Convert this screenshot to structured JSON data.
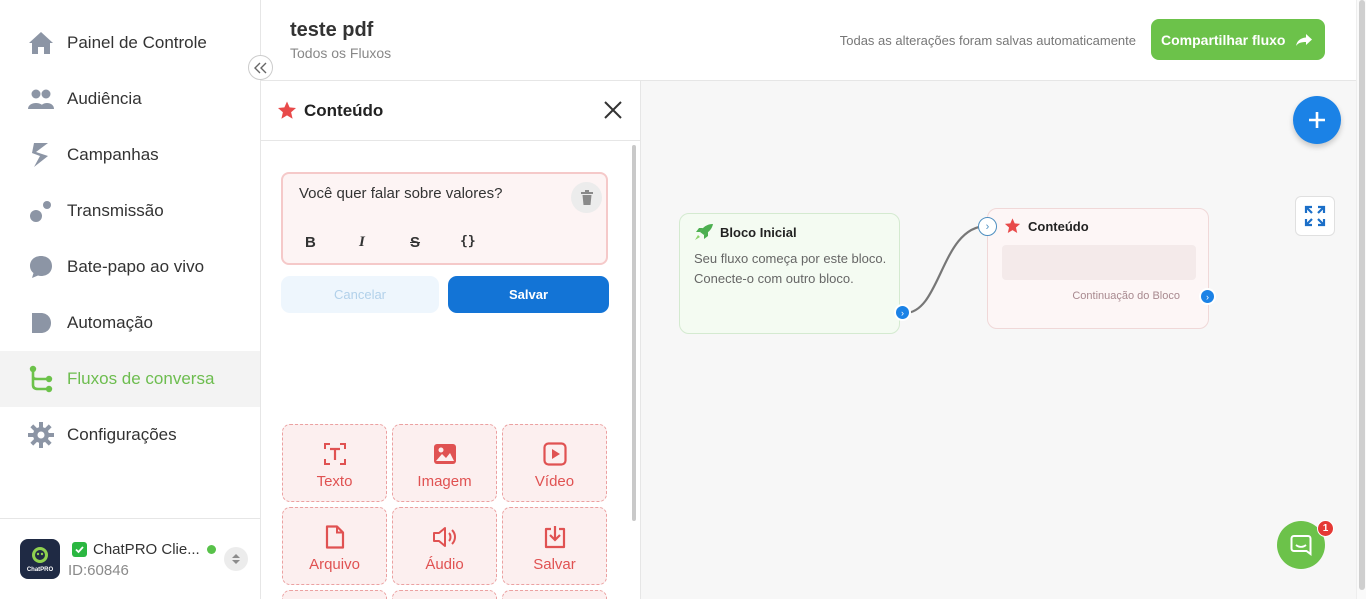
{
  "sidebar": {
    "items": [
      {
        "label": "Painel de Controle",
        "icon": "home-icon"
      },
      {
        "label": "Audiência",
        "icon": "users-icon"
      },
      {
        "label": "Campanhas",
        "icon": "campaign-icon"
      },
      {
        "label": "Transmissão",
        "icon": "broadcast-icon"
      },
      {
        "label": "Bate-papo ao vivo",
        "icon": "chat-bubble-icon"
      },
      {
        "label": "Automação",
        "icon": "automation-icon"
      },
      {
        "label": "Fluxos de conversa",
        "icon": "flow-icon"
      },
      {
        "label": "Configurações",
        "icon": "gear-icon"
      }
    ],
    "active_index": 6,
    "account": {
      "name": "ChatPRO Clie...",
      "id": "ID:60846",
      "status": "online",
      "avatar_text": "ChatPRO"
    }
  },
  "header": {
    "title": "teste pdf",
    "subtitle": "Todos os Fluxos",
    "autosave_text": "Todas as alterações foram salvas automaticamente",
    "share_label": "Compartilhar fluxo"
  },
  "panel": {
    "title": "Conteúdo",
    "editor_text": "Você quer falar sobre valores?",
    "format_buttons": [
      "B",
      "I",
      "S",
      "{}"
    ],
    "cancel_label": "Cancelar",
    "save_label": "Salvar",
    "tiles": [
      {
        "label": "Texto",
        "icon": "text-icon"
      },
      {
        "label": "Imagem",
        "icon": "image-icon"
      },
      {
        "label": "Vídeo",
        "icon": "video-icon"
      },
      {
        "label": "Arquivo",
        "icon": "file-icon"
      },
      {
        "label": "Áudio",
        "icon": "audio-icon"
      },
      {
        "label": "Salvar",
        "icon": "download-icon"
      }
    ]
  },
  "canvas": {
    "start_node": {
      "title": "Bloco Inicial",
      "desc": "Seu fluxo começa por este bloco. Conecte-o com outro bloco."
    },
    "content_node": {
      "title": "Conteúdo",
      "continuation": "Continuação do Bloco"
    },
    "chat_badge": "1"
  },
  "colors": {
    "accent_green": "#6cc24a",
    "accent_blue": "#1b82e6",
    "danger_red": "#e05252"
  }
}
